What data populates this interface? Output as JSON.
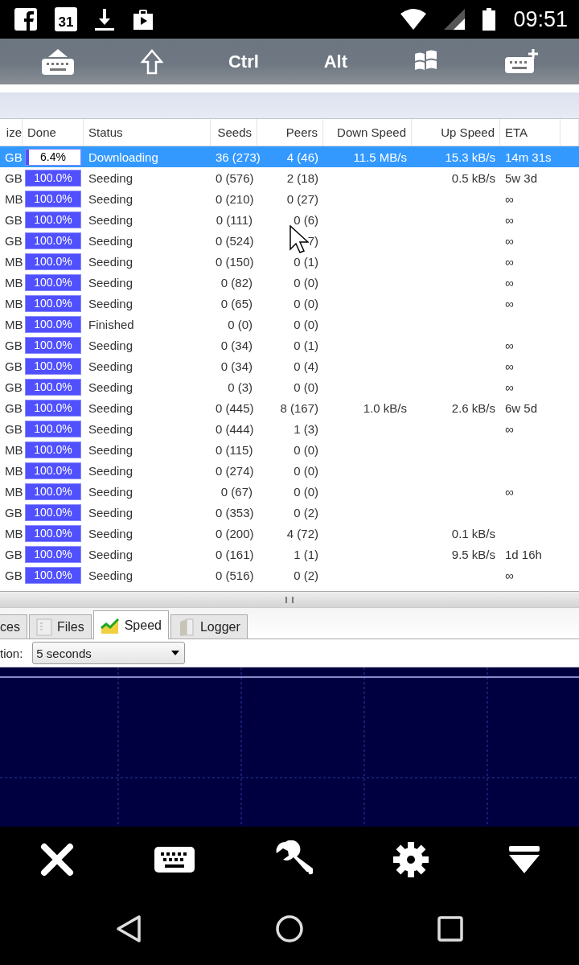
{
  "status_bar": {
    "calendar_day": "31",
    "time": "09:51"
  },
  "key_bar": {
    "keys": [
      "Ctrl",
      "Alt"
    ]
  },
  "table": {
    "columns": [
      "ize",
      "Done",
      "Status",
      "Seeds",
      "Peers",
      "Down Speed",
      "Up Speed",
      "ETA"
    ],
    "rows": [
      {
        "size": "GB",
        "done": "6.4%",
        "level": 0.064,
        "status": "Downloading",
        "seeds": "36 (273)",
        "peers": "4 (46)",
        "down": "11.5 MB/s",
        "up": "15.3 kB/s",
        "eta": "14m 31s",
        "selected": true
      },
      {
        "size": "GB",
        "done": "100.0%",
        "level": 1,
        "status": "Seeding",
        "seeds": "0 (576)",
        "peers": "2 (18)",
        "up": "0.5 kB/s",
        "eta": "5w 3d",
        "selected": false
      },
      {
        "size": "MB",
        "done": "100.0%",
        "level": 1,
        "status": "Seeding",
        "seeds": "0 (210)",
        "peers": "0 (27)",
        "eta": "∞",
        "selected": false
      },
      {
        "size": "GB",
        "done": "100.0%",
        "level": 1,
        "status": "Seeding",
        "seeds": "0 (111)",
        "peers": "0 (6)",
        "eta": "∞",
        "selected": false
      },
      {
        "size": "GB",
        "done": "100.0%",
        "level": 1,
        "status": "Seeding",
        "seeds": "0 (524)",
        "peers": "7)",
        "eta": "∞",
        "selected": false
      },
      {
        "size": "MB",
        "done": "100.0%",
        "level": 1,
        "status": "Seeding",
        "seeds": "0 (150)",
        "peers": "0 (1)",
        "eta": "∞",
        "selected": false
      },
      {
        "size": "MB",
        "done": "100.0%",
        "level": 1,
        "status": "Seeding",
        "seeds": "0 (82)",
        "peers": "0 (0)",
        "eta": "∞",
        "selected": false
      },
      {
        "size": "MB",
        "done": "100.0%",
        "level": 1,
        "status": "Seeding",
        "seeds": "0 (65)",
        "peers": "0 (0)",
        "eta": "∞",
        "selected": false
      },
      {
        "size": "MB",
        "done": "100.0%",
        "level": 1,
        "status": "Finished",
        "seeds": "0 (0)",
        "peers": "0 (0)",
        "selected": false
      },
      {
        "size": "GB",
        "done": "100.0%",
        "level": 1,
        "status": "Seeding",
        "seeds": "0 (34)",
        "peers": "0 (1)",
        "eta": "∞",
        "selected": false
      },
      {
        "size": "GB",
        "done": "100.0%",
        "level": 1,
        "status": "Seeding",
        "seeds": "0 (34)",
        "peers": "0 (4)",
        "eta": "∞",
        "selected": false
      },
      {
        "size": "GB",
        "done": "100.0%",
        "level": 1,
        "status": "Seeding",
        "seeds": "0 (3)",
        "peers": "0 (0)",
        "eta": "∞",
        "selected": false
      },
      {
        "size": "GB",
        "done": "100.0%",
        "level": 1,
        "status": "Seeding",
        "seeds": "0 (445)",
        "peers": "8 (167)",
        "down": "1.0 kB/s",
        "up": "2.6 kB/s",
        "eta": "6w 5d",
        "selected": false
      },
      {
        "size": "GB",
        "done": "100.0%",
        "level": 1,
        "status": "Seeding",
        "seeds": "0 (444)",
        "peers": "1 (3)",
        "eta": "∞",
        "selected": false
      },
      {
        "size": "MB",
        "done": "100.0%",
        "level": 1,
        "status": "Seeding",
        "seeds": "0 (115)",
        "peers": "0 (0)",
        "selected": false
      },
      {
        "size": "MB",
        "done": "100.0%",
        "level": 1,
        "status": "Seeding",
        "seeds": "0 (274)",
        "peers": "0 (0)",
        "selected": false
      },
      {
        "size": "MB",
        "done": "100.0%",
        "level": 1,
        "status": "Seeding",
        "seeds": "0 (67)",
        "peers": "0 (0)",
        "eta": "∞",
        "selected": false
      },
      {
        "size": "GB",
        "done": "100.0%",
        "level": 1,
        "status": "Seeding",
        "seeds": "0 (353)",
        "peers": "0 (2)",
        "selected": false
      },
      {
        "size": "MB",
        "done": "100.0%",
        "level": 1,
        "status": "Seeding",
        "seeds": "0 (200)",
        "peers": "4 (72)",
        "up": "0.1 kB/s",
        "selected": false
      },
      {
        "size": "GB",
        "done": "100.0%",
        "level": 1,
        "status": "Seeding",
        "seeds": "0 (161)",
        "peers": "1 (1)",
        "up": "9.5 kB/s",
        "eta": "1d 16h",
        "selected": false
      },
      {
        "size": "GB",
        "done": "100.0%",
        "level": 1,
        "status": "Seeding",
        "seeds": "0 (516)",
        "peers": "0 (2)",
        "eta": "∞",
        "selected": false
      }
    ]
  },
  "detail_tabs": [
    {
      "label": "ces",
      "selected": false
    },
    {
      "label": "Files",
      "selected": false
    },
    {
      "label": "Speed",
      "selected": true
    },
    {
      "label": "Logger",
      "selected": false
    }
  ],
  "speed_panel": {
    "label": "tion:",
    "dropdown": "5 seconds"
  }
}
